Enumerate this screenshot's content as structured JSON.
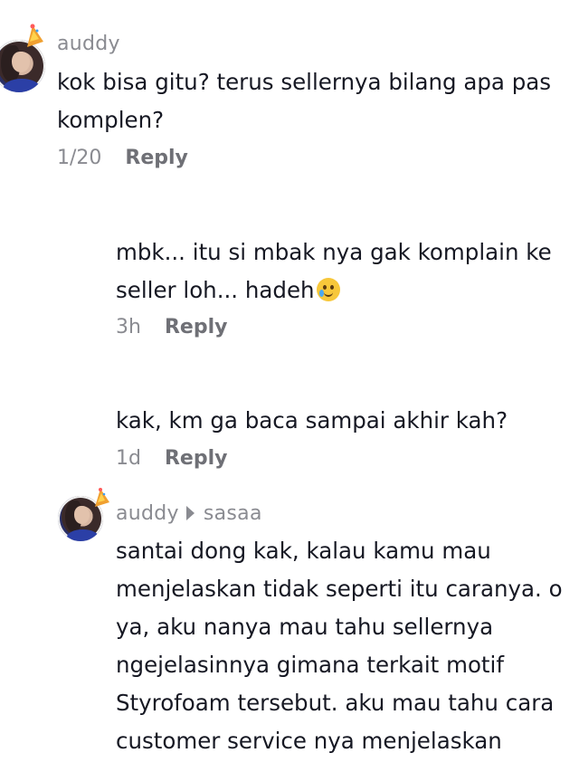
{
  "comments": [
    {
      "username": "auddy",
      "text_lines": [
        "kok bisa gitu? terus sellernya bilang apa pas",
        "komplen?"
      ],
      "time": "1/20",
      "reply_label": "Reply"
    },
    {
      "text_lines": [
        "mbk... itu si mbak nya gak komplain ke",
        "seller loh... hadeh"
      ],
      "time": "3h",
      "reply_label": "Reply"
    },
    {
      "text_lines": [
        "kak, km ga baca sampai akhir kah?"
      ],
      "time": "1d",
      "reply_label": "Reply"
    },
    {
      "username": "auddy",
      "reply_to": "sasaa",
      "text_lines": [
        "santai dong kak, kalau kamu mau",
        "menjelaskan tidak seperti itu caranya. o",
        "ya, aku nanya mau tahu sellernya",
        "ngejelasinnya gimana terkait motif",
        "Styrofoam tersebut. aku mau tahu cara",
        "customer service nya menjelaskan"
      ]
    }
  ],
  "colors": {
    "text": "#161823",
    "secondary": "#8a8b91",
    "reply": "#6f7076"
  },
  "icons": {
    "party_hat": "party-hat-icon",
    "reply_arrow": "play-arrow-icon",
    "emoji": "tear-smile-emoji"
  }
}
